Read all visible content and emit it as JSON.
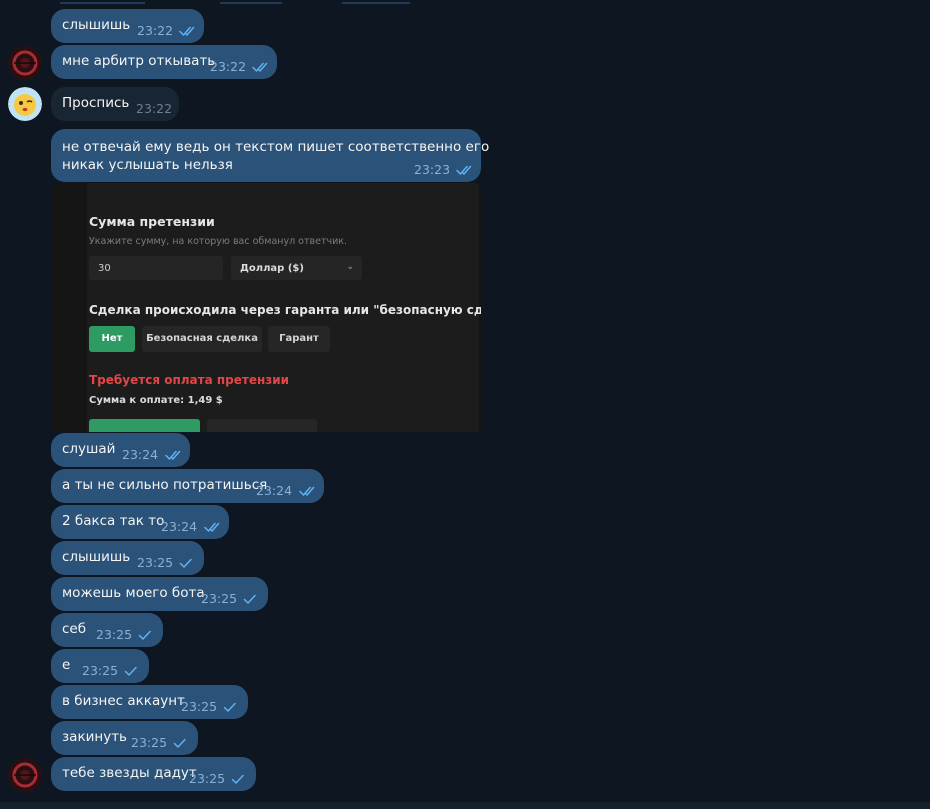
{
  "colors": {
    "background": "#0e1621",
    "outgoing_bubble": "#2b5278",
    "incoming_bubble": "#182533",
    "tick": "#5fb3f2",
    "screenshot_green": "#2e9b63",
    "screenshot_red": "#e24646"
  },
  "messages": [
    {
      "text": "слышишь",
      "time": "23:22",
      "read": true
    },
    {
      "text": "мне арбитр откывать",
      "time": "23:22",
      "read": true
    },
    {
      "text": "Проспись",
      "time": "23:22",
      "incoming": true
    },
    {
      "text_line1": "не отвечай ему ведь он текстом пишет соответственно его",
      "text_line2": "никак услышать нельзя",
      "time": "23:23",
      "read": true
    },
    {
      "text": "слушай",
      "time": "23:24",
      "read": true
    },
    {
      "text": "а ты не сильно потратишься",
      "time": "23:24",
      "read": true
    },
    {
      "text": "2 бакса так то",
      "time": "23:24",
      "read": true
    },
    {
      "text": "слышишь",
      "time": "23:25",
      "read": false
    },
    {
      "text": "можешь моего бота",
      "time": "23:25",
      "read": false
    },
    {
      "text": "себ",
      "time": "23:25",
      "read": false
    },
    {
      "text": "е",
      "time": "23:25",
      "read": false
    },
    {
      "text": "в бизнес аккаунт",
      "time": "23:25",
      "read": false
    },
    {
      "text": "закинуть",
      "time": "23:25",
      "read": false
    },
    {
      "text": "тебе звезды дадут",
      "time": "23:25",
      "read": false
    }
  ],
  "screenshot": {
    "claim_title": "Сумма претензии",
    "claim_hint": "Укажите сумму, на которую вас обманул ответчик.",
    "amount_value": "30",
    "currency_selected": "Доллар ($)",
    "guarantor_question": "Сделка происходила через гаранта или \"безопасную сделку\"?",
    "options": [
      "Нет",
      "Безопасная сделка",
      "Гарант"
    ],
    "selected_option": "Нет",
    "payment_required": "Требуется оплата претензии",
    "payment_amount": "Сумма к оплате: 1,49 $"
  }
}
